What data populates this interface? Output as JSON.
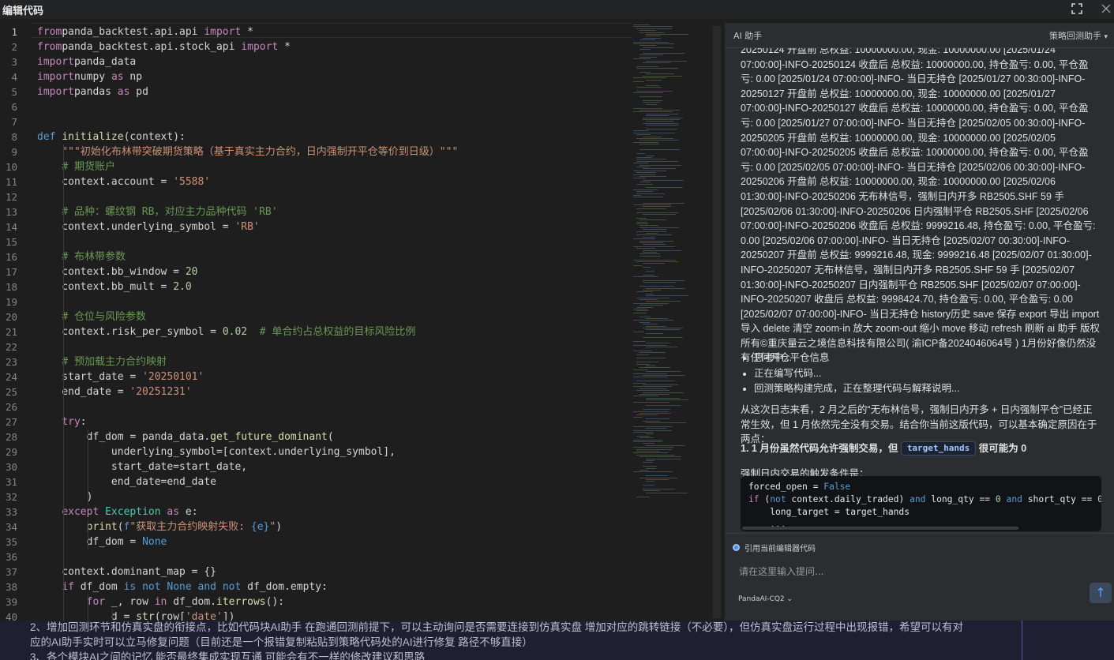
{
  "window": {
    "title": "编辑代码"
  },
  "editor": {
    "active_line": 1,
    "lines": [
      [
        [
          "kw2",
          "from"
        ],
        [
          "",
          "panda_backtest.api.api "
        ],
        [
          "kw2",
          "import"
        ],
        [
          "",
          " *"
        ]
      ],
      [
        [
          "kw2",
          "from"
        ],
        [
          "",
          "panda_backtest.api.stock_api "
        ],
        [
          "kw2",
          "import"
        ],
        [
          "",
          " *"
        ]
      ],
      [
        [
          "kw2",
          "import"
        ],
        [
          "",
          "panda_data"
        ]
      ],
      [
        [
          "kw2",
          "import"
        ],
        [
          "",
          "numpy "
        ],
        [
          "kw2",
          "as"
        ],
        [
          "",
          " np"
        ]
      ],
      [
        [
          "kw2",
          "import"
        ],
        [
          "",
          "pandas "
        ],
        [
          "kw2",
          "as"
        ],
        [
          "",
          " pd"
        ]
      ],
      [],
      [],
      [
        [
          "kw",
          "def"
        ],
        [
          "",
          " "
        ],
        [
          "fn",
          "initialize"
        ],
        [
          "",
          "(context):"
        ]
      ],
      [
        [
          "",
          "    "
        ],
        [
          "str",
          "\"\"\"初始化布林带突破期货策略（基于真实主力合约，日内强制开平仓等价到日级）\"\"\""
        ]
      ],
      [
        [
          "",
          "    "
        ],
        [
          "cm",
          "# 期货账户"
        ]
      ],
      [
        [
          "",
          "    context.account = "
        ],
        [
          "str",
          "'5588'"
        ]
      ],
      [],
      [
        [
          "",
          "    "
        ],
        [
          "cm",
          "# 品种：螺纹钢 RB，对应主力品种代码 'RB'"
        ]
      ],
      [
        [
          "",
          "    context.underlying_symbol = "
        ],
        [
          "str",
          "'RB'"
        ]
      ],
      [],
      [
        [
          "",
          "    "
        ],
        [
          "cm",
          "# 布林带参数"
        ]
      ],
      [
        [
          "",
          "    context.bb_window = "
        ],
        [
          "num",
          "20"
        ]
      ],
      [
        [
          "",
          "    context.bb_mult = "
        ],
        [
          "num",
          "2.0"
        ]
      ],
      [],
      [
        [
          "",
          "    "
        ],
        [
          "cm",
          "# 仓位与风险参数"
        ]
      ],
      [
        [
          "",
          "    context.risk_per_symbol = "
        ],
        [
          "num",
          "0.02"
        ],
        [
          "",
          "  "
        ],
        [
          "cm",
          "# 单合约占总权益的目标风险比例"
        ]
      ],
      [],
      [
        [
          "",
          "    "
        ],
        [
          "cm",
          "# 预加载主力合约映射"
        ]
      ],
      [
        [
          "",
          "    start_date = "
        ],
        [
          "str",
          "'20250101'"
        ]
      ],
      [
        [
          "",
          "    end_date = "
        ],
        [
          "str",
          "'20251231'"
        ]
      ],
      [],
      [
        [
          "",
          "    "
        ],
        [
          "kw2",
          "try"
        ],
        [
          "",
          ":"
        ]
      ],
      [
        [
          "",
          "        df_dom = panda_data."
        ],
        [
          "fn",
          "get_future_dominant"
        ],
        [
          "",
          "("
        ]
      ],
      [
        [
          "",
          "            underlying_symbol=[context.underlying_symbol],"
        ]
      ],
      [
        [
          "",
          "            start_date=start_date,"
        ]
      ],
      [
        [
          "",
          "            end_date=end_date"
        ]
      ],
      [
        [
          "",
          "        )"
        ]
      ],
      [
        [
          "",
          "    "
        ],
        [
          "kw2",
          "except"
        ],
        [
          "",
          " "
        ],
        [
          "cls",
          "Exception"
        ],
        [
          "",
          " "
        ],
        [
          "kw2",
          "as"
        ],
        [
          "",
          " e:"
        ]
      ],
      [
        [
          "",
          "        "
        ],
        [
          "fn",
          "print"
        ],
        [
          "",
          "("
        ],
        [
          "kw",
          "f"
        ],
        [
          "str",
          "\"获取主力合约映射失败: "
        ],
        [
          "kw",
          "{e}"
        ],
        [
          "str",
          "\""
        ],
        [
          "",
          ")"
        ]
      ],
      [
        [
          "",
          "        df_dom = "
        ],
        [
          "kw",
          "None"
        ]
      ],
      [],
      [
        [
          "",
          "    context.dominant_map = {}"
        ]
      ],
      [
        [
          "",
          "    "
        ],
        [
          "kw2",
          "if"
        ],
        [
          "",
          " df_dom "
        ],
        [
          "kw",
          "is not None"
        ],
        [
          "",
          " "
        ],
        [
          "kw",
          "and not"
        ],
        [
          "",
          " df_dom.empty:"
        ]
      ],
      [
        [
          "",
          "        "
        ],
        [
          "kw2",
          "for"
        ],
        [
          "",
          " _, row "
        ],
        [
          "kw2",
          "in"
        ],
        [
          "",
          " df_dom."
        ],
        [
          "fn",
          "iterrows"
        ],
        [
          "",
          "():"
        ]
      ],
      [
        [
          "",
          "            d = "
        ],
        [
          "fn",
          "str"
        ],
        [
          "",
          "(row["
        ],
        [
          "str",
          "'date'"
        ],
        [
          "",
          "])"
        ]
      ]
    ]
  },
  "ai_panel": {
    "title": "AI 助手",
    "mode": "策略回测助手",
    "log_text": "20250124 开盘前 总权益: 10000000.00, 现金: 10000000.00 [2025/01/24 07:00:00]-INFO-20250124 收盘后 总权益: 10000000.00, 持仓盈亏: 0.00, 平仓盈亏: 0.00 [2025/01/24 07:00:00]-INFO- 当日无持仓 [2025/01/27 00:30:00]-INFO-20250127 开盘前 总权益: 10000000.00, 现金: 10000000.00 [2025/01/27 07:00:00]-INFO-20250127 收盘后 总权益: 10000000.00, 持仓盈亏: 0.00, 平仓盈亏: 0.00 [2025/01/27 07:00:00]-INFO- 当日无持仓 [2025/02/05 00:30:00]-INFO-20250205 开盘前 总权益: 10000000.00, 现金: 10000000.00 [2025/02/05 07:00:00]-INFO-20250205 收盘后 总权益: 10000000.00, 持仓盈亏: 0.00, 平仓盈亏: 0.00 [2025/02/05 07:00:00]-INFO- 当日无持仓 [2025/02/06 00:30:00]-INFO-20250206 开盘前 总权益: 10000000.00, 现金: 10000000.00 [2025/02/06 01:30:00]-INFO-20250206 无布林信号，强制日内开多 RB2505.SHF 59 手 [2025/02/06 01:30:00]-INFO-20250206 日内强制平仓 RB2505.SHF [2025/02/06 07:00:00]-INFO-20250206 收盘后 总权益: 9999216.48, 持仓盈亏: 0.00, 平仓盈亏: 0.00 [2025/02/06 07:00:00]-INFO- 当日无持仓 [2025/02/07 00:30:00]-INFO-20250207 开盘前 总权益: 9999216.48, 现金: 9999216.48 [2025/02/07 01:30:00]-INFO-20250207 无布林信号，强制日内开多 RB2505.SHF 59 手 [2025/02/07 01:30:00]-INFO-20250207 日内强制平仓 RB2505.SHF [2025/02/07 07:00:00]-INFO-20250207 收盘后 总权益: 9998424.70, 持仓盈亏: 0.00, 平仓盈亏: 0.00 [2025/02/07 07:00:00]-INFO- 当日无持仓 history历史 save 保存 export 导出 import 导入 delete 清空 zoom-in 放大 zoom-out 缩小 move 移动 refresh 刷新 ai 助手 版权所有©重庆量云之境信息科技有限公司( 渝ICP备2024046064号 ) 1月份好像仍然没有任何开仓平仓信息",
    "bullets": [
      "思考中...",
      "正在编写代码...",
      "回测策略构建完成，正在整理代码与解释说明..."
    ],
    "analysis": "从这次日志来看，2 月之后的“无布林信号，强制日内开多 + 日内强制平仓”已经正常生效，但 1 月依然完全没有交易。结合你当前这版代码，可以基本确定原因在于两点：",
    "heading_prefix": "1. 1 月份虽然代码允许强制交易，但",
    "heading_chip": "target_hands",
    "heading_suffix": "很可能为 0",
    "trigger_text": "强制日内交易的触发条件是：",
    "code_lines": [
      [
        [
          "",
          "forced_open = "
        ],
        [
          "kw",
          "False"
        ]
      ],
      [
        [
          "kw2",
          "if"
        ],
        [
          "",
          " ("
        ],
        [
          "kw",
          "not"
        ],
        [
          "",
          " context.daily_traded) "
        ],
        [
          "kw",
          "and"
        ],
        [
          "",
          " long_qty == "
        ],
        [
          "num",
          "0"
        ],
        [
          "",
          " "
        ],
        [
          "kw",
          "and"
        ],
        [
          "",
          " short_qty == "
        ],
        [
          "num",
          "0"
        ],
        [
          "",
          " a"
        ]
      ],
      [
        [
          "",
          "    long_target = target_hands"
        ]
      ],
      [
        [
          "",
          "    ..."
        ]
      ]
    ],
    "ref_label": "引用当前编辑器代码",
    "input_placeholder": "请在这里输入提问...",
    "model": "PandaAI-CQ2 ⌄"
  },
  "background_text": [
    "2、增加回测环节和仿真实盘的衔接点，比如代码块AI助手 在跑通回测前提下，可以主动询问是否需要连接到仿真实盘 增加对应的跳转链接（不必要），但仿真实盘运行过程中出现报错，希望可以有对",
    "应的AI助手实时可以立马修复问题（目前还是一个报错复制粘贴到策略代码处的AI进行修复 路径不够直接）",
    "3、各个模块AI之间的记忆 能否最终集成实现互通 可能会有不一样的修改建议和思路"
  ]
}
